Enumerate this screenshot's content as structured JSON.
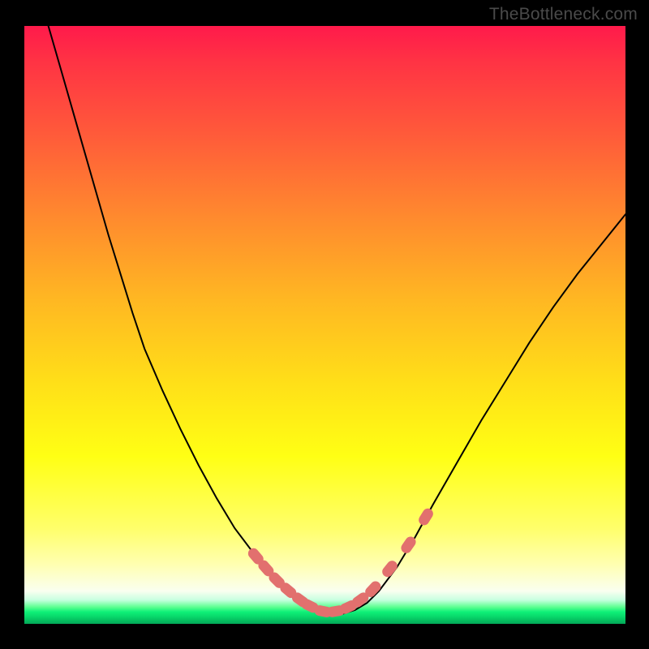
{
  "watermark": "TheBottleneck.com",
  "colors": {
    "background": "#000000",
    "curve_stroke": "#000000",
    "marker_fill": "#e2706e",
    "gradient_top": "#ff1a4b",
    "gradient_bottom": "#03a858"
  },
  "chart_data": {
    "type": "line",
    "title": "",
    "xlabel": "",
    "ylabel": "",
    "xlim": [
      0,
      100
    ],
    "ylim": [
      0,
      100
    ],
    "note": "x and y are in percent of the plot area; y=0 is the top, y=100 is the bottom. The curve is a V-shaped bottleneck curve. Markers highlight sampled points near the minimum.",
    "series": [
      {
        "name": "bottleneck-curve",
        "x": [
          4.0,
          6.0,
          8.0,
          10.0,
          12.0,
          14.0,
          16.0,
          18.0,
          20.0,
          23.0,
          26.0,
          29.0,
          32.0,
          35.0,
          38.0,
          41.0,
          44.0,
          47.0,
          49.0,
          51.0,
          53.0,
          55.0,
          57.0,
          59.0,
          62.0,
          65.0,
          68.0,
          72.0,
          76.0,
          80.0,
          84.0,
          88.0,
          92.0,
          96.0,
          100.0
        ],
        "y": [
          0.0,
          7.0,
          14.0,
          21.0,
          28.0,
          35.0,
          41.5,
          48.0,
          54.0,
          61.0,
          67.5,
          73.5,
          79.0,
          84.0,
          88.0,
          91.5,
          94.5,
          96.5,
          97.7,
          98.3,
          98.3,
          97.7,
          96.5,
          94.5,
          90.5,
          85.5,
          80.0,
          73.0,
          66.0,
          59.5,
          53.0,
          47.0,
          41.5,
          36.5,
          31.5
        ]
      }
    ],
    "markers": {
      "name": "sample-points",
      "x": [
        38.5,
        40.2,
        42.0,
        43.9,
        45.9,
        47.5,
        49.7,
        51.8,
        53.9,
        55.9,
        58.0,
        60.8,
        63.9,
        66.8
      ],
      "y": [
        88.7,
        90.7,
        92.7,
        94.4,
        96.0,
        97.0,
        97.9,
        97.9,
        97.2,
        96.0,
        94.2,
        90.8,
        86.8,
        82.1
      ]
    }
  }
}
